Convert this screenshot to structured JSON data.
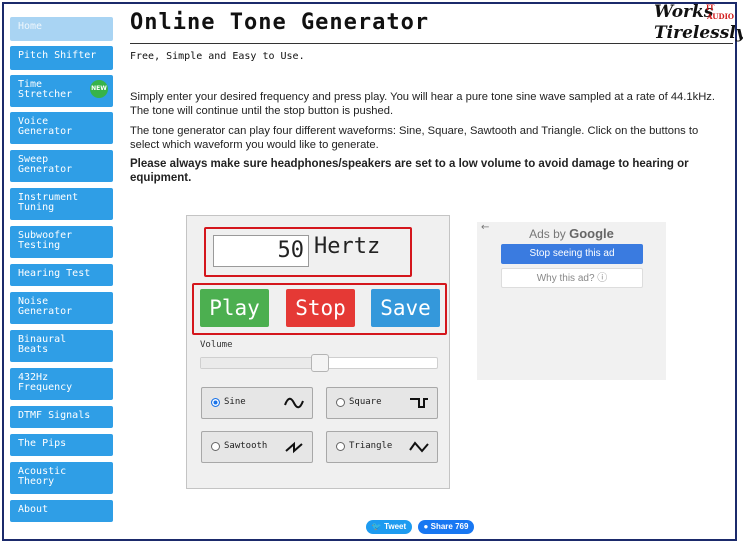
{
  "page": {
    "title": "Online Tone Generator",
    "subtitle": "Free, Simple and Easy to Use.",
    "logo": {
      "line1": "Works",
      "line2": "Tirelessly",
      "badge_top": "IT",
      "badge_bottom": "AUDIO"
    }
  },
  "sidebar": {
    "items": [
      {
        "label": "Home",
        "active": true
      },
      {
        "label": "Pitch Shifter"
      },
      {
        "label": "Time\nStretcher",
        "badge": "NEW"
      },
      {
        "label": "Voice\nGenerator"
      },
      {
        "label": "Sweep\nGenerator"
      },
      {
        "label": "Instrument\nTuning"
      },
      {
        "label": "Subwoofer\nTesting"
      },
      {
        "label": "Hearing Test"
      },
      {
        "label": "Noise\nGenerator"
      },
      {
        "label": "Binaural\nBeats"
      },
      {
        "label": "432Hz\nFrequency"
      },
      {
        "label": "DTMF Signals"
      },
      {
        "label": "The Pips"
      },
      {
        "label": "Acoustic\nTheory"
      },
      {
        "label": "About"
      }
    ]
  },
  "intro": {
    "p1": "Simply enter your desired frequency and press play. You will hear a pure tone sine wave sampled at a rate of 44.1kHz. The tone will continue until the stop button is pushed.",
    "p2": "The tone generator can play four different waveforms: Sine, Square, Sawtooth and Triangle. Click on the buttons to select which waveform you would like to generate.",
    "warning": "Please always make sure headphones/speakers are set to a low volume to avoid damage to hearing or equipment."
  },
  "generator": {
    "frequency_value": "50",
    "unit": "Hertz",
    "buttons": {
      "play": "Play",
      "stop": "Stop",
      "save": "Save"
    },
    "volume_label": "Volume",
    "volume_level": 0.5,
    "waveforms": [
      {
        "label": "Sine",
        "selected": true,
        "icon": "sine-wave-icon"
      },
      {
        "label": "Square",
        "selected": false,
        "icon": "square-wave-icon"
      },
      {
        "label": "Sawtooth",
        "selected": false,
        "icon": "sawtooth-wave-icon"
      },
      {
        "label": "Triangle",
        "selected": false,
        "icon": "triangle-wave-icon"
      }
    ],
    "colors": {
      "play": "#4caf50",
      "stop": "#e53935",
      "save": "#3498db",
      "highlight": "#d4161c"
    }
  },
  "ad": {
    "back_icon": "left-arrow-icon",
    "title_prefix": "Ads by",
    "title_brand": "Google",
    "stop_button": "Stop seeing this ad",
    "why_link": "Why this ad? ⓘ"
  },
  "share": {
    "tweet": "Tweet",
    "facebook": "Share 769"
  }
}
